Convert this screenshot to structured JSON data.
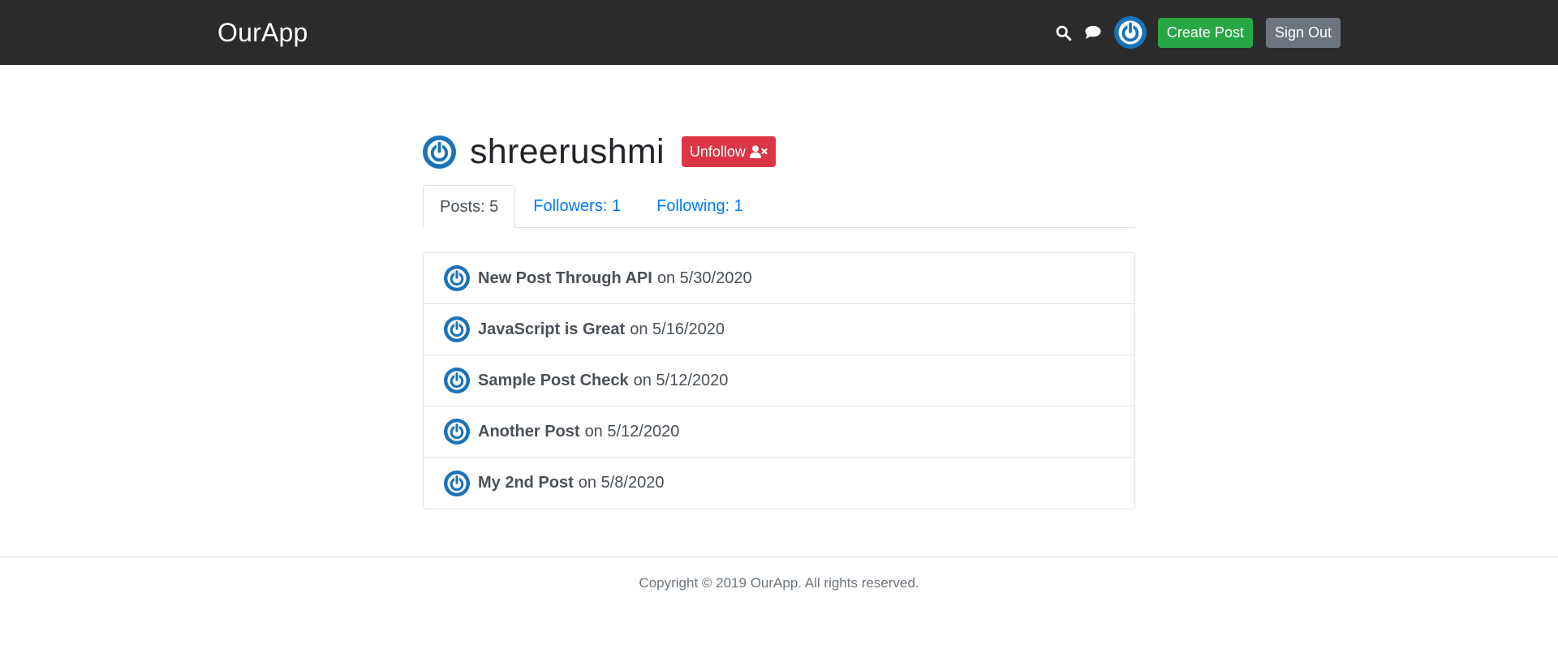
{
  "header": {
    "brand": "OurApp",
    "create_post_label": "Create Post",
    "sign_out_label": "Sign Out",
    "icons": [
      "search-icon",
      "chat-icon"
    ],
    "colors": {
      "background": "#2b2b2b",
      "success": "#28a745",
      "secondary": "#6c757d"
    }
  },
  "profile": {
    "username": "shreerushmi",
    "unfollow_label": "Unfollow",
    "unfollow_color": "#dc3545",
    "avatar_color": "#1a73b8"
  },
  "tabs": [
    {
      "label": "Posts: 5",
      "active": true
    },
    {
      "label": "Followers: 1",
      "active": false
    },
    {
      "label": "Following: 1",
      "active": false
    }
  ],
  "posts": [
    {
      "title": "New Post Through API",
      "date": "on 5/30/2020"
    },
    {
      "title": "JavaScript is Great",
      "date": "on 5/16/2020"
    },
    {
      "title": "Sample Post Check",
      "date": "on 5/12/2020"
    },
    {
      "title": "Another Post",
      "date": "on 5/12/2020"
    },
    {
      "title": "My 2nd Post",
      "date": "on 5/8/2020"
    }
  ],
  "footer": {
    "text": "Copyright © 2019 OurApp. All rights reserved."
  }
}
